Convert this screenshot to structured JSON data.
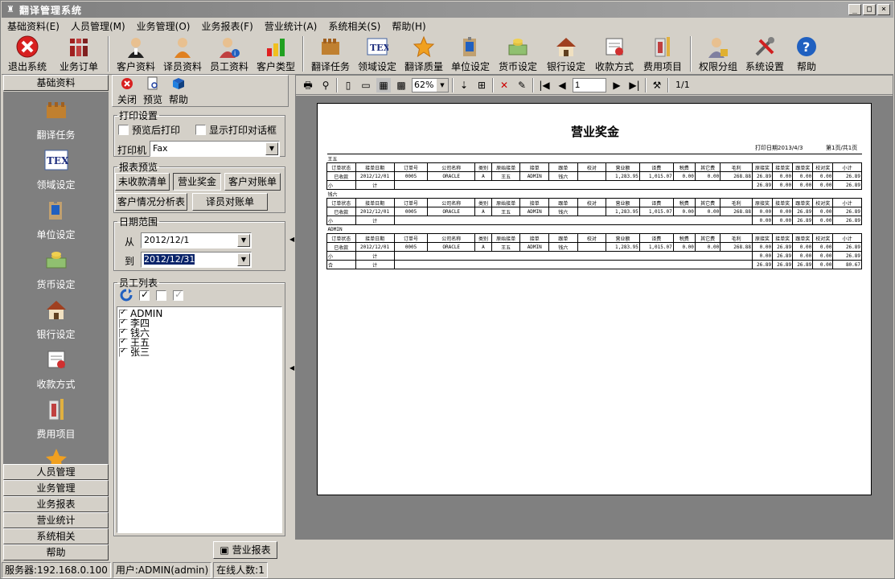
{
  "window": {
    "title": "翻译管理系统"
  },
  "menu": [
    "基础资料(E)",
    "人员管理(M)",
    "业务管理(O)",
    "业务报表(F)",
    "营业统计(A)",
    "系统相关(S)",
    "帮助(H)"
  ],
  "toolbar": [
    {
      "label": "退出系统",
      "icon": "exit-icon"
    },
    {
      "label": "业务订单",
      "icon": "order-icon"
    },
    {
      "label": "客户资料",
      "icon": "customer-icon"
    },
    {
      "label": "译员资料",
      "icon": "translator-icon"
    },
    {
      "label": "员工资料",
      "icon": "employee-icon"
    },
    {
      "label": "客户类型",
      "icon": "customer-type-icon"
    },
    {
      "label": "翻译任务",
      "icon": "task-icon"
    },
    {
      "label": "领域设定",
      "icon": "tex-icon"
    },
    {
      "label": "翻译质量",
      "icon": "star-icon"
    },
    {
      "label": "单位设定",
      "icon": "unit-icon"
    },
    {
      "label": "货币设定",
      "icon": "currency-icon"
    },
    {
      "label": "银行设定",
      "icon": "bank-icon"
    },
    {
      "label": "收款方式",
      "icon": "payment-icon"
    },
    {
      "label": "费用项目",
      "icon": "expense-icon"
    },
    {
      "label": "权限分组",
      "icon": "permission-icon"
    },
    {
      "label": "系统设置",
      "icon": "settings-icon"
    },
    {
      "label": "帮助",
      "icon": "help-icon"
    }
  ],
  "leftnav": {
    "header": "基础资料",
    "items": [
      {
        "label": "翻译任务",
        "icon": "task-icon"
      },
      {
        "label": "领域设定",
        "icon": "tex-icon"
      },
      {
        "label": "单位设定",
        "icon": "unit-icon"
      },
      {
        "label": "货币设定",
        "icon": "currency-icon"
      },
      {
        "label": "银行设定",
        "icon": "bank-icon"
      },
      {
        "label": "收款方式",
        "icon": "payment-icon"
      },
      {
        "label": "费用项目",
        "icon": "expense-icon"
      }
    ],
    "sections": [
      "人员管理",
      "业务管理",
      "业务报表",
      "营业统计",
      "系统相关",
      "帮助"
    ]
  },
  "subtoolbar": {
    "close": "关闭",
    "preview": "预览",
    "help": "帮助"
  },
  "print_settings": {
    "legend": "打印设置",
    "preview_after_print": "预览后打印",
    "show_print_dialog": "显示打印对话框",
    "printer_label": "打印机",
    "printer_value": "Fax"
  },
  "report_preview": {
    "legend": "报表预览",
    "buttons": [
      "未收款清单",
      "营业奖金",
      "客户对账单",
      "客户情况分析表",
      "译员对账单"
    ]
  },
  "date_range": {
    "legend": "日期范围",
    "from_label": "从",
    "from_value": "2012/12/1",
    "to_label": "到",
    "to_value": "2012/12/31"
  },
  "employee_list": {
    "legend": "员工列表",
    "items": [
      "ADMIN",
      "李四",
      "钱六",
      "王五",
      "张三"
    ]
  },
  "preview_toolbar": {
    "zoom": "62%",
    "page": "1",
    "page_count": "1/1"
  },
  "report": {
    "title": "营业奖金",
    "print_date": "打印日期2013/4/3",
    "page_info": "第1页/共1页",
    "headers": [
      "订单状态",
      "接单日期",
      "订单号",
      "公司名称",
      "类别",
      "原始接单",
      "接单",
      "跟单",
      "校对",
      "营业额",
      "译费",
      "税费",
      "其它费",
      "毛利",
      "原接奖",
      "接单奖",
      "跟单奖",
      "校对奖",
      "小计"
    ],
    "groups": [
      {
        "name": "王五",
        "row": [
          "已收款",
          "2012/12/01",
          "0005",
          "ORACLE",
          "A",
          "王五",
          "ADMIN",
          "钱六",
          "",
          "1,283.95",
          "1,015.07",
          "0.00",
          "0.00",
          "268.88",
          "26.89",
          "0.00",
          "0.00",
          "0.00",
          "26.89"
        ],
        "subtotal": [
          "26.89",
          "0.00",
          "0.00",
          "0.00",
          "26.89"
        ]
      },
      {
        "name": "钱六",
        "row": [
          "已收款",
          "2012/12/01",
          "0005",
          "ORACLE",
          "A",
          "王五",
          "ADMIN",
          "钱六",
          "",
          "1,283.95",
          "1,015.07",
          "0.00",
          "0.00",
          "268.88",
          "0.00",
          "0.00",
          "26.89",
          "0.00",
          "26.89"
        ],
        "subtotal": [
          "0.00",
          "0.00",
          "26.89",
          "0.00",
          "26.89"
        ]
      },
      {
        "name": "ADMIN",
        "row": [
          "已收款",
          "2012/12/01",
          "0005",
          "ORACLE",
          "A",
          "王五",
          "ADMIN",
          "钱六",
          "",
          "1,283.95",
          "1,015.07",
          "0.00",
          "0.00",
          "268.88",
          "0.00",
          "26.89",
          "0.00",
          "0.00",
          "26.89"
        ],
        "subtotal": [
          "0.00",
          "26.89",
          "0.00",
          "0.00",
          "26.89"
        ]
      }
    ],
    "subtotal_label": [
      "小",
      "计"
    ],
    "total_label": [
      "合",
      "计"
    ],
    "total": [
      "26.89",
      "26.89",
      "26.89",
      "0.00",
      "80.67"
    ]
  },
  "bottom_tab": "营业报表",
  "status": {
    "server": "服务器:192.168.0.100",
    "user": "用户:ADMIN(admin)",
    "online": "在线人数:1"
  }
}
